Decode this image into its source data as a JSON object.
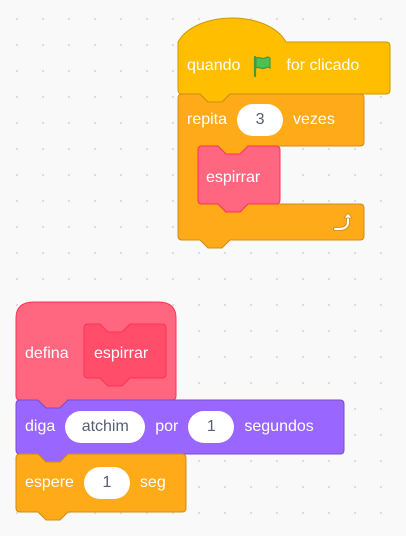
{
  "colors": {
    "events": "#ffbf00",
    "events_border": "#cc9900",
    "control": "#ffab19",
    "control_border": "#cf8b17",
    "custom": "#ff6680",
    "custom_border": "#ff3355",
    "custom_inner": "#ff4d6a",
    "looks": "#9966ff",
    "looks_border": "#774dcb",
    "flag": "#4cbf56",
    "input_text": "#575e75"
  },
  "script_top": {
    "hat": {
      "label_when": "quando",
      "flag_icon": "green-flag-icon",
      "label_clicked": "for clicado"
    },
    "repeat": {
      "label": "repita",
      "times": "3",
      "label_times": "vezes",
      "loop_icon": "loop-arrow-icon"
    },
    "inner_call": {
      "label": "espirrar"
    }
  },
  "script_bottom": {
    "define": {
      "label": "defina",
      "proc_name": "espirrar"
    },
    "say_for": {
      "label_say": "diga",
      "message": "atchim",
      "label_for": "por",
      "secs": "1",
      "label_seconds": "segundos"
    },
    "wait": {
      "label": "espere",
      "secs": "1",
      "label_secs": "seg"
    }
  }
}
